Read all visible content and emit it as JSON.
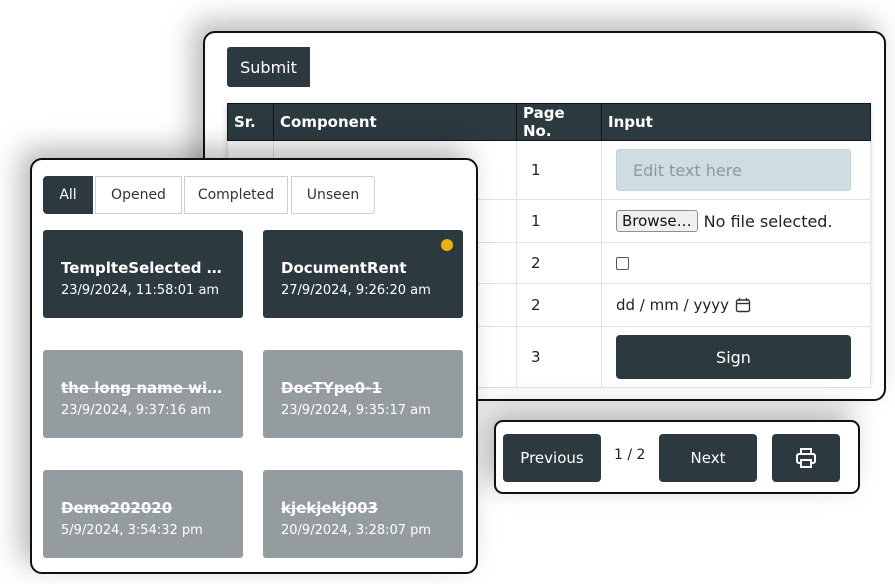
{
  "form": {
    "submit_label": "Submit",
    "table": {
      "headers": [
        "Sr.",
        "Component",
        "Page No.",
        "Input"
      ],
      "rows": [
        {
          "page": "1",
          "input_placeholder": "Edit text here"
        },
        {
          "page": "1",
          "browse_label": "Browse…",
          "file_status": "No file selected."
        },
        {
          "page": "2",
          "checked": false
        },
        {
          "page": "2",
          "date_placeholder": "dd / mm / yyyy"
        },
        {
          "page": "3",
          "sign_label": "Sign"
        }
      ]
    }
  },
  "pager": {
    "previous_label": "Previous",
    "page_indicator": "1 / 2",
    "next_label": "Next",
    "print_icon": "printer-icon"
  },
  "documents": {
    "tabs": [
      {
        "label": "All",
        "active": true
      },
      {
        "label": "Opened",
        "active": false
      },
      {
        "label": "Completed",
        "active": false
      },
      {
        "label": "Unseen",
        "active": false
      }
    ],
    "items": [
      {
        "title": "TemplteSelected Doc",
        "date": "23/9/2024, 11:58:01 am",
        "state": "open"
      },
      {
        "title": "DocumentRent",
        "date": "27/9/2024, 9:26:20 am",
        "state": "open",
        "unseen_dot": true
      },
      {
        "title": "the long name with very long text",
        "date": "23/9/2024, 9:37:16 am",
        "state": "completed"
      },
      {
        "title": "DocTYpe0-1",
        "date": "23/9/2024, 9:35:17 am",
        "state": "completed"
      },
      {
        "title": "Demo202020",
        "date": "5/9/2024, 3:54:32 pm",
        "state": "completed"
      },
      {
        "title": "kjekjekj003",
        "date": "20/9/2024, 3:28:07 pm",
        "state": "completed"
      }
    ]
  },
  "colors": {
    "primary_dark": "#2c3a40",
    "completed_grey": "#959c9f",
    "unseen_dot": "#e8b10c",
    "input_fill": "#cfdde3"
  }
}
